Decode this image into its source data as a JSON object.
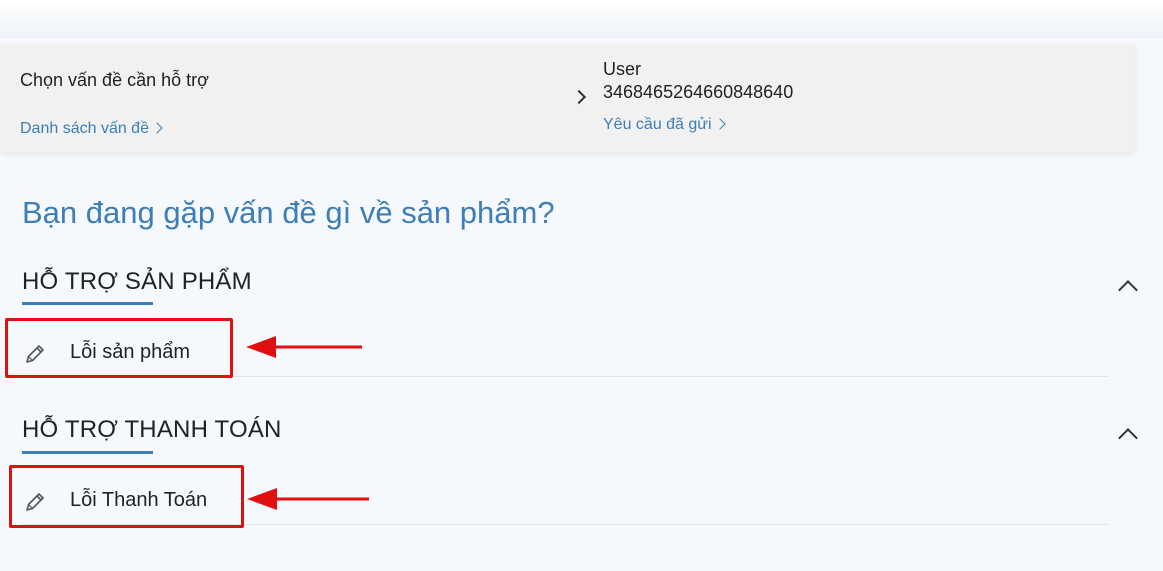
{
  "header": {
    "choose_title": "Chọn vấn đề cần hỗ trợ",
    "issue_list_link": "Danh sách vấn đề",
    "user_label": "User",
    "user_id": "346846526466084864​0",
    "sent_requests_link": "Yêu cầu đã gửi"
  },
  "main": {
    "question": "Bạn đang gặp vấn đề gì về sản phẩm?",
    "sections": [
      {
        "title": "HỖ TRỢ SẢN PHẨM",
        "items": [
          {
            "label": "Lỗi sản phẩm",
            "icon": "pencil-icon"
          }
        ]
      },
      {
        "title": "HỖ TRỢ THANH TOÁN",
        "items": [
          {
            "label": "Lỗi Thanh Toán",
            "icon": "pencil-icon"
          }
        ]
      }
    ]
  },
  "colors": {
    "accent": "#3e7eb6",
    "annotation": "#e01010",
    "background": "#f5f8fc",
    "header_bg": "#f1f1f1"
  }
}
